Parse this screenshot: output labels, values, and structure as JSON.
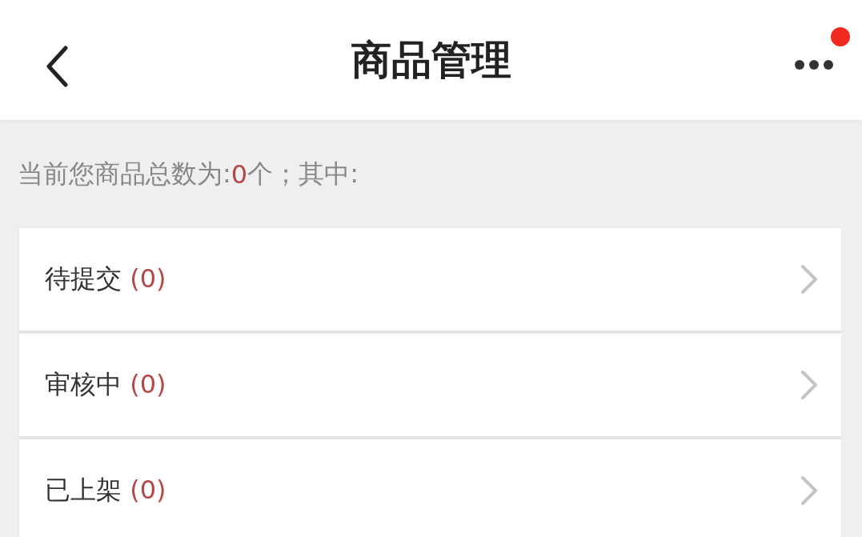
{
  "header": {
    "title": "商品管理",
    "more_unread": true
  },
  "summary": {
    "prefix": "当前您商品总数为:",
    "count": "0",
    "suffix": "个；其中:"
  },
  "rows": [
    {
      "label": "待提交",
      "count": "(0)"
    },
    {
      "label": "审核中",
      "count": "(0)"
    },
    {
      "label": "已上架",
      "count": "(0)"
    }
  ]
}
